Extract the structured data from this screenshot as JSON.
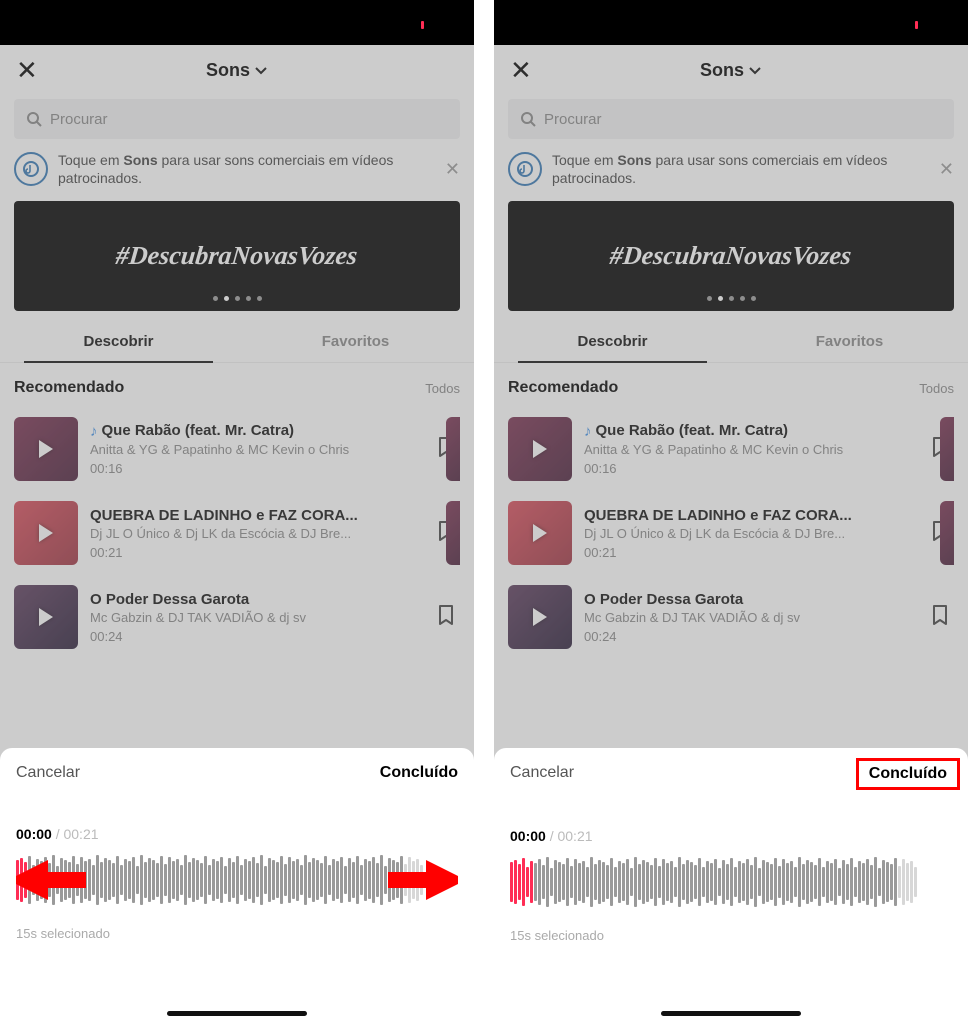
{
  "header": {
    "title": "Sons"
  },
  "search": {
    "placeholder": "Procurar"
  },
  "info_banner": {
    "prefix": "Toque em ",
    "bold": "Sons",
    "suffix": " para usar sons comerciais em vídeos patrocinados."
  },
  "promo_banner": {
    "hashtag": "#DescubraNovasVozes"
  },
  "tabs": {
    "discover": "Descobrir",
    "favorites": "Favoritos"
  },
  "section": {
    "title": "Recomendado",
    "all": "Todos"
  },
  "songs": [
    {
      "title": "Que Rabão (feat. Mr. Catra)",
      "artist": "Anitta & YG & Papatinho & MC Kevin o Chris",
      "duration": "00:16",
      "has_note": true,
      "cover": "linear-gradient(135deg,#7a3050,#4a1f3a)"
    },
    {
      "title": "QUEBRA DE LADINHO e FAZ CORA...",
      "artist": "Dj JL O Único & Dj LK da Escócia & DJ Bre...",
      "duration": "00:21",
      "has_note": false,
      "cover": "linear-gradient(135deg,#d84c5a,#9e3442)"
    },
    {
      "title": "O Poder Dessa Garota",
      "artist": "Mc Gabzin & DJ TAK VADIÃO & dj sv",
      "duration": "00:24",
      "has_note": false,
      "cover": "linear-gradient(135deg,#5c3b5c,#2b1f3a)"
    }
  ],
  "editor": {
    "cancel": "Cancelar",
    "done": "Concluído",
    "current": "00:00",
    "total": "00:21",
    "selected_label": "15s selecionado"
  },
  "waveform_heights": [
    40,
    44,
    36,
    48,
    30,
    42,
    38,
    46,
    34,
    50,
    28,
    44,
    40,
    36,
    48,
    32,
    46,
    38,
    42,
    30,
    50,
    36,
    44,
    40,
    34,
    48,
    30,
    42,
    38,
    46,
    28,
    50,
    36,
    44,
    40,
    34,
    48,
    32,
    46,
    38,
    42,
    30,
    50,
    36,
    44,
    40,
    34,
    48,
    30,
    42,
    38,
    46,
    28,
    44,
    36,
    48,
    30,
    42,
    38,
    46,
    34,
    50,
    28,
    44,
    40,
    36,
    48,
    32,
    46,
    38,
    42,
    30,
    50,
    36,
    44,
    40,
    34,
    48,
    30,
    42,
    38,
    46,
    28,
    44,
    36,
    48,
    30,
    42,
    38,
    46,
    34,
    50,
    28,
    44,
    40,
    36,
    48,
    32,
    46,
    38,
    42,
    30
  ],
  "left_panel": {
    "red_bars": 3,
    "arrows": true
  },
  "right_panel": {
    "red_bars": 6,
    "arrows": false,
    "highlight_done": true
  }
}
